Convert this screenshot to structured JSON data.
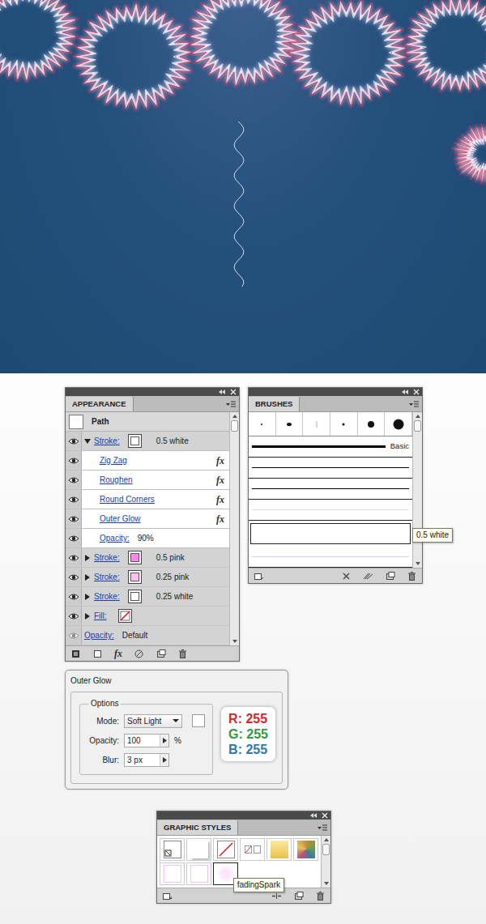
{
  "appearance": {
    "title": "APPEARANCE",
    "header": "Path",
    "rows": [
      {
        "kind": "stroke",
        "label": "Stroke:",
        "value": "0.5 white",
        "color": "#ffffff",
        "expanded": true,
        "visible": true
      },
      {
        "kind": "effect",
        "label": "Zig Zag",
        "fx": "fx",
        "visible": true
      },
      {
        "kind": "effect",
        "label": "Roughen",
        "fx": "fx",
        "visible": true
      },
      {
        "kind": "effect",
        "label": "Round Corners",
        "fx": "fx",
        "visible": true
      },
      {
        "kind": "effect",
        "label": "Outer Glow",
        "fx": "fx",
        "visible": true
      },
      {
        "kind": "setting",
        "label": "Opacity:",
        "value": "90%",
        "visible": true
      },
      {
        "kind": "stroke",
        "label": "Stroke:",
        "value": "0.5 pink",
        "color": "#ff88f0",
        "expanded": false,
        "visible": true
      },
      {
        "kind": "stroke",
        "label": "Stroke:",
        "value": "0.25 pink",
        "color": "#ffc2ec",
        "expanded": false,
        "visible": true
      },
      {
        "kind": "stroke",
        "label": "Stroke:",
        "value": "0.25 white",
        "color": "#ffffff",
        "expanded": false,
        "visible": true
      },
      {
        "kind": "fill",
        "label": "Fill:",
        "expanded": false,
        "visible": true
      },
      {
        "kind": "opacity",
        "label": "Opacity:",
        "value": "Default",
        "visible": true
      }
    ],
    "footer_fx": "fx"
  },
  "brushes": {
    "title": "BRUSHES",
    "dots": [
      {
        "kind": "dot"
      },
      {
        "kind": "dash"
      },
      {
        "kind": "tick"
      },
      {
        "kind": "dot"
      },
      {
        "kind": "dot"
      },
      {
        "kind": "dot"
      }
    ],
    "strokes": [
      {
        "kind": "basic",
        "label": "Basic",
        "color": "#000000",
        "selected": false
      },
      {
        "kind": "line",
        "color": "#000000",
        "selected": false
      },
      {
        "kind": "line",
        "color": "#000000",
        "selected": false
      },
      {
        "kind": "line",
        "color": "#dcdce6",
        "selected": false
      },
      {
        "kind": "line",
        "color": "#ffffff",
        "selected": true,
        "tooltip": "0.5 white"
      },
      {
        "kind": "line",
        "color": "#d9c9f2",
        "selected": false
      }
    ]
  },
  "outer_glow": {
    "title": "Outer Glow",
    "group": "Options",
    "mode_label": "Mode:",
    "mode": "Soft Light",
    "color": "#ffffff",
    "opacity_label": "Opacity:",
    "opacity": "100",
    "opacity_unit": "%",
    "blur_label": "Blur:",
    "blur": "3 px",
    "rgb": [
      {
        "text": "R: 255",
        "color": "#d9262b"
      },
      {
        "text": "G: 255",
        "color": "#2e9a45"
      },
      {
        "text": "B: 255",
        "color": "#2b78b8"
      }
    ]
  },
  "graphic_styles": {
    "title": "GRAPHIC STYLES",
    "swatches": [
      {
        "kind": "default",
        "selected": false
      },
      {
        "kind": "shadow",
        "selected": false
      },
      {
        "kind": "none",
        "selected": false
      },
      {
        "kind": "pair",
        "selected": false
      },
      {
        "kind": "gold",
        "selected": false
      },
      {
        "kind": "mosaic",
        "selected": false
      },
      {
        "kind": "pink",
        "selected": false
      },
      {
        "kind": "pink",
        "selected": false
      },
      {
        "kind": "glow",
        "selected": true,
        "tooltip": "fadingSpark"
      }
    ]
  }
}
